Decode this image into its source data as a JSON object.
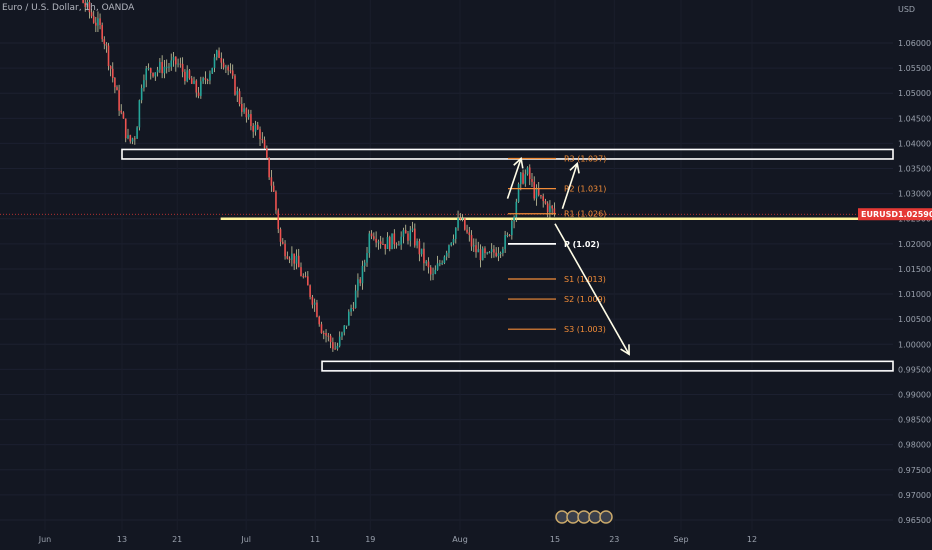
{
  "header": {
    "title": "Euro / U.S. Dollar, 1h, OANDA",
    "currency": "USD"
  },
  "colors": {
    "background": "#131722",
    "up": "#26a69a",
    "down": "#ef5350",
    "wick": "#c9c9a0",
    "zone": "#ffffff",
    "level_line": "#fff59d",
    "pivot": "#f28c38",
    "pivot_main": "#ffffff",
    "arrow": "#fffde7",
    "badge": "#e53935",
    "axis_text": "#9aa1ad"
  },
  "chart_data": {
    "type": "candlestick",
    "title": "Euro / U.S. Dollar, 1h, OANDA",
    "ylabel": "USD",
    "ylim": [
      0.964,
      1.069
    ],
    "yticks": [
      "1.06000",
      "1.05500",
      "1.05000",
      "1.04500",
      "1.04000",
      "1.03500",
      "1.03000",
      "1.02500",
      "1.02000",
      "1.01500",
      "1.01000",
      "1.00500",
      "1.00000",
      "0.99500",
      "0.99000",
      "0.98500",
      "0.98000",
      "0.97500",
      "0.97000",
      "0.96500"
    ],
    "xticks": [
      "Jun",
      "13",
      "21",
      "Jul",
      "11",
      "19",
      "Aug",
      "15",
      "23",
      "Sep",
      "12"
    ],
    "price_path": [
      {
        "d": "Jun 1",
        "v": 1.073
      },
      {
        "d": "Jun 6",
        "v": 1.07
      },
      {
        "d": "Jun 10",
        "v": 1.062
      },
      {
        "d": "Jun 13",
        "v": 1.045
      },
      {
        "d": "Jun 14",
        "v": 1.04
      },
      {
        "d": "Jun 15",
        "v": 1.042
      },
      {
        "d": "Jun 16",
        "v": 1.054
      },
      {
        "d": "Jun 21",
        "v": 1.056
      },
      {
        "d": "Jun 24",
        "v": 1.05
      },
      {
        "d": "Jun 27",
        "v": 1.058
      },
      {
        "d": "Jun 28",
        "v": 1.056
      },
      {
        "d": "Jul 1",
        "v": 1.045
      },
      {
        "d": "Jul 3",
        "v": 1.042
      },
      {
        "d": "Jul 5",
        "v": 1.03
      },
      {
        "d": "Jul 6",
        "v": 1.02
      },
      {
        "d": "Jul 8",
        "v": 1.017
      },
      {
        "d": "Jul 11",
        "v": 1.008
      },
      {
        "d": "Jul 12",
        "v": 1.003
      },
      {
        "d": "Jul 14",
        "v": 0.999
      },
      {
        "d": "Jul 15",
        "v": 1.002
      },
      {
        "d": "Jul 18",
        "v": 1.015
      },
      {
        "d": "Jul 19",
        "v": 1.023
      },
      {
        "d": "Jul 21",
        "v": 1.02
      },
      {
        "d": "Jul 25",
        "v": 1.022
      },
      {
        "d": "Jul 28",
        "v": 1.013
      },
      {
        "d": "Aug 1",
        "v": 1.025
      },
      {
        "d": "Aug 3",
        "v": 1.019
      },
      {
        "d": "Aug 5",
        "v": 1.017
      },
      {
        "d": "Aug 8",
        "v": 1.021
      },
      {
        "d": "Aug 10",
        "v": 1.033
      },
      {
        "d": "Aug 11",
        "v": 1.034
      },
      {
        "d": "Aug 12",
        "v": 1.03
      },
      {
        "d": "Aug 15",
        "v": 1.0259
      }
    ],
    "last_price": {
      "symbol": "EURUSD",
      "value": "1.02590",
      "price": 1.0259
    },
    "zones": [
      {
        "name": "resistance-zone",
        "start": "Jun 13",
        "end": "right-edge",
        "low": 1.0375,
        "high": 1.0382
      },
      {
        "name": "support-zone",
        "start": "Jul 12",
        "end": "right-edge",
        "low": 0.9953,
        "high": 0.996
      }
    ],
    "level": {
      "price": 1.025,
      "start": "Jul 6"
    },
    "pivots": [
      {
        "label": "R3 (1.037)",
        "price": 1.037
      },
      {
        "label": "R2 (1.031)",
        "price": 1.031
      },
      {
        "label": "R1 (1.026)",
        "price": 1.026
      },
      {
        "label": "P (1.02)",
        "price": 1.02,
        "main": true
      },
      {
        "label": "S1 (1.013)",
        "price": 1.013
      },
      {
        "label": "S2 (1.009)",
        "price": 1.009
      },
      {
        "label": "S3 (1.003)",
        "price": 1.003
      }
    ],
    "arrows": [
      {
        "name": "bullish-arrow",
        "from": {
          "d": "Aug 8",
          "v": 1.029
        },
        "to": {
          "d": "Aug 10",
          "v": 1.037
        }
      },
      {
        "name": "bullish-arrow-2",
        "from": {
          "d": "Aug 16",
          "v": 1.027
        },
        "to": {
          "d": "Aug 18",
          "v": 1.036
        }
      },
      {
        "name": "bearish-arrow",
        "from": {
          "d": "Aug 15",
          "v": 1.024
        },
        "to": {
          "d": "Aug 25",
          "v": 0.998
        }
      }
    ]
  }
}
